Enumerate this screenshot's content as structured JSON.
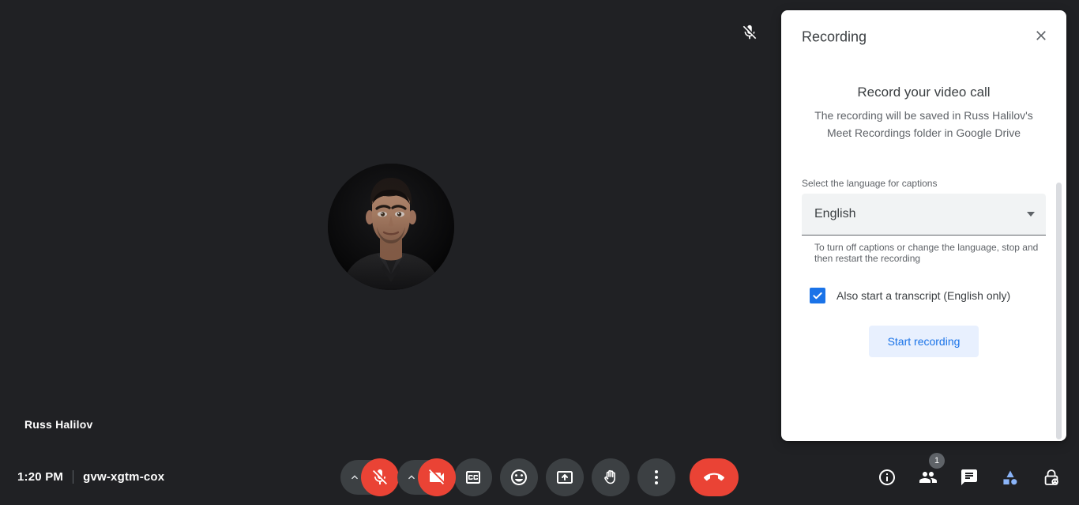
{
  "meeting": {
    "self_name": "Russ Halilov",
    "time": "1:20 PM",
    "meeting_code": "gvw-xgtm-cox",
    "mic_status_icon": "mic-off-icon"
  },
  "controls": {
    "mic_toggle": {
      "label": "Turn on microphone",
      "icon": "mic-off-icon",
      "state": "muted"
    },
    "mic_options": {
      "label": "Audio settings",
      "icon": "chevron-up-icon"
    },
    "camera_toggle": {
      "label": "Turn on camera",
      "icon": "videocam-off-icon",
      "state": "off"
    },
    "camera_options": {
      "label": "Video settings",
      "icon": "chevron-up-icon"
    },
    "captions": {
      "label": "Turn on captions",
      "icon": "closed-caption-icon"
    },
    "reactions": {
      "label": "Send a reaction",
      "icon": "emoji-smile-icon"
    },
    "present": {
      "label": "Present now",
      "icon": "present-screen-icon"
    },
    "raise_hand": {
      "label": "Raise hand",
      "icon": "raised-hand-icon"
    },
    "more_options": {
      "label": "More options",
      "icon": "more-vert-icon"
    },
    "leave_call": {
      "label": "Leave call",
      "icon": "end-call-icon"
    }
  },
  "right_panel_icons": {
    "meeting_details": {
      "label": "Meeting details",
      "icon": "info-icon"
    },
    "people": {
      "label": "Show everyone",
      "icon": "people-icon",
      "badge": "1"
    },
    "chat": {
      "label": "Chat with everyone",
      "icon": "chat-bubble-icon"
    },
    "activities": {
      "label": "Activities",
      "icon": "activities-shapes-icon"
    },
    "host_controls": {
      "label": "Host controls",
      "icon": "lock-person-icon"
    }
  },
  "dialog": {
    "header_title": "Recording",
    "close_icon": "close-icon",
    "promo_title": "Record your video call",
    "promo_subtitle": "The recording will be saved in Russ Halilov's Meet Recordings folder in Google Drive",
    "language_field_label": "Select the language for captions",
    "language_value": "English",
    "language_arrow_icon": "chevron-down-icon",
    "language_helper": "To turn off captions or change the language, stop and then restart the recording",
    "transcript_checkbox_label": "Also start a transcript (English only)",
    "transcript_checked": true,
    "start_button_label": "Start recording"
  },
  "colors": {
    "app_background": "#202124",
    "dialog_background": "#ffffff",
    "accent_blue": "#1a73e8",
    "button_blue_bg": "#e8f0fe",
    "danger_red": "#ea4335",
    "control_gray": "#3c4043"
  }
}
